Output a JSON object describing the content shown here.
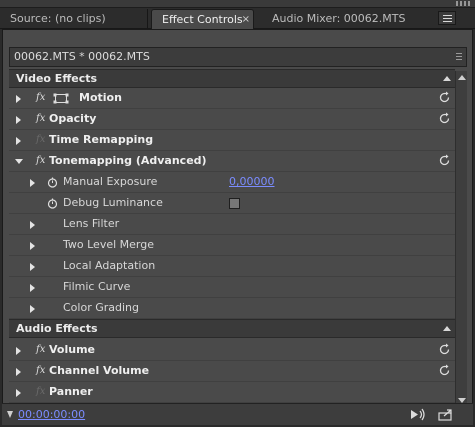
{
  "tabs": [
    {
      "label": "Source: (no clips)",
      "active": false
    },
    {
      "label": "Effect Controls",
      "active": true,
      "close": "×"
    },
    {
      "label": "Audio Mixer: 00062.MTS",
      "active": false
    }
  ],
  "clip_bar": "00062.MTS * 00062.MTS",
  "video_section": "Video Effects",
  "audio_section": "Audio Effects",
  "video_effects": [
    {
      "label": "Motion"
    },
    {
      "label": "Opacity"
    },
    {
      "label": "Time Remapping"
    },
    {
      "label": "Tonemapping (Advanced)"
    }
  ],
  "tonemapping_params": {
    "manual_exposure_label": "Manual Exposure",
    "manual_exposure_value": "0,00000",
    "debug_luminance_label": "Debug Luminance",
    "debug_luminance_checked": false,
    "groups": [
      "Lens Filter",
      "Two Level Merge",
      "Local Adaptation",
      "Filmic Curve",
      "Color Grading"
    ]
  },
  "audio_effects": [
    {
      "label": "Volume"
    },
    {
      "label": "Channel Volume"
    },
    {
      "label": "Panner"
    }
  ],
  "fx_symbol": "fx",
  "footer": {
    "timecode": "00:00:00:00"
  },
  "icons": {
    "reset": "reset-icon",
    "stopwatch": "stopwatch-icon",
    "motion": "motion-transform-icon",
    "play": "play-audio-icon",
    "export": "export-icon"
  },
  "colors": {
    "link": "#7b8cff",
    "panel": "#4a4a4a",
    "section": "#3a3a3a"
  }
}
